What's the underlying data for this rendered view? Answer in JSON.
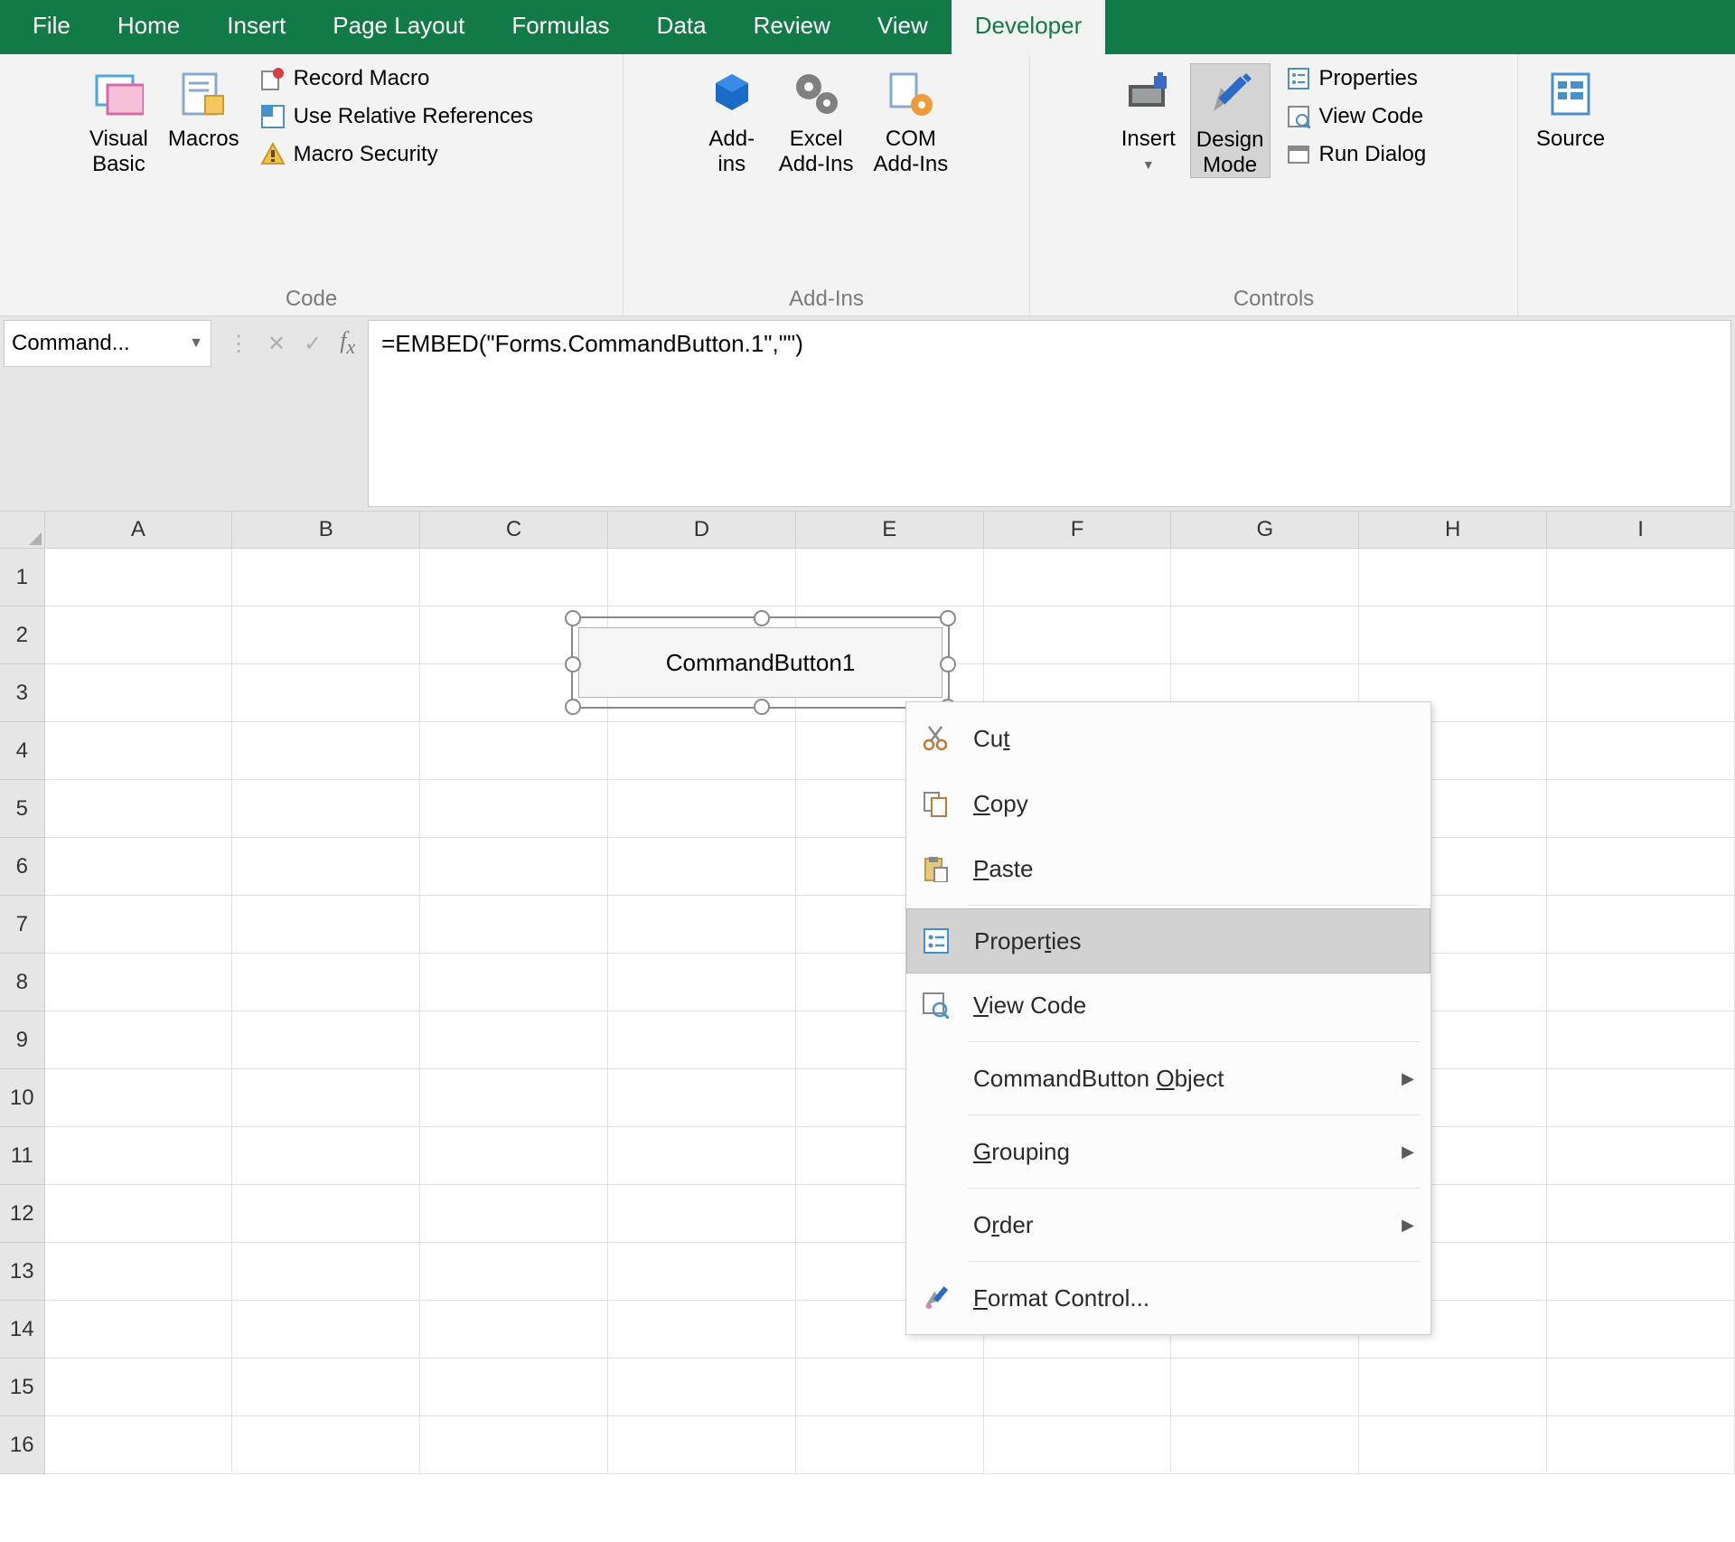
{
  "tabs": {
    "file": "File",
    "home": "Home",
    "insert": "Insert",
    "pagelayout": "Page Layout",
    "formulas": "Formulas",
    "data": "Data",
    "review": "Review",
    "view": "View",
    "developer": "Developer",
    "active": "developer"
  },
  "ribbon": {
    "code": {
      "label": "Code",
      "visual_basic": "Visual\nBasic",
      "macros": "Macros",
      "record_macro": "Record Macro",
      "relative_refs": "Use Relative References",
      "macro_security": "Macro Security"
    },
    "addins": {
      "label": "Add-Ins",
      "addins": "Add-\nins",
      "excel_addins": "Excel\nAdd-Ins",
      "com_addins": "COM\nAdd-Ins"
    },
    "controls": {
      "label": "Controls",
      "insert": "Insert",
      "design_mode": "Design\nMode",
      "properties": "Properties",
      "view_code": "View Code",
      "run_dialog": "Run Dialog"
    },
    "source": {
      "source": "Source"
    }
  },
  "namebox": "Command...",
  "formula": "=EMBED(\"Forms.CommandButton.1\",\"\")",
  "columns": [
    "A",
    "B",
    "C",
    "D",
    "E",
    "F",
    "G",
    "H",
    "I"
  ],
  "rows": [
    "1",
    "2",
    "3",
    "4",
    "5",
    "6",
    "7",
    "8",
    "9",
    "10",
    "11",
    "12",
    "13",
    "14",
    "15",
    "16"
  ],
  "object_label": "CommandButton1",
  "context_menu": {
    "cut": "Cut",
    "copy": "Copy",
    "paste": "Paste",
    "properties": "Properties",
    "view_code": "View Code",
    "object": "CommandButton Object",
    "grouping": "Grouping",
    "order": "Order",
    "format": "Format Control...",
    "hover": "properties"
  },
  "colors": {
    "brand": "#127a47"
  }
}
